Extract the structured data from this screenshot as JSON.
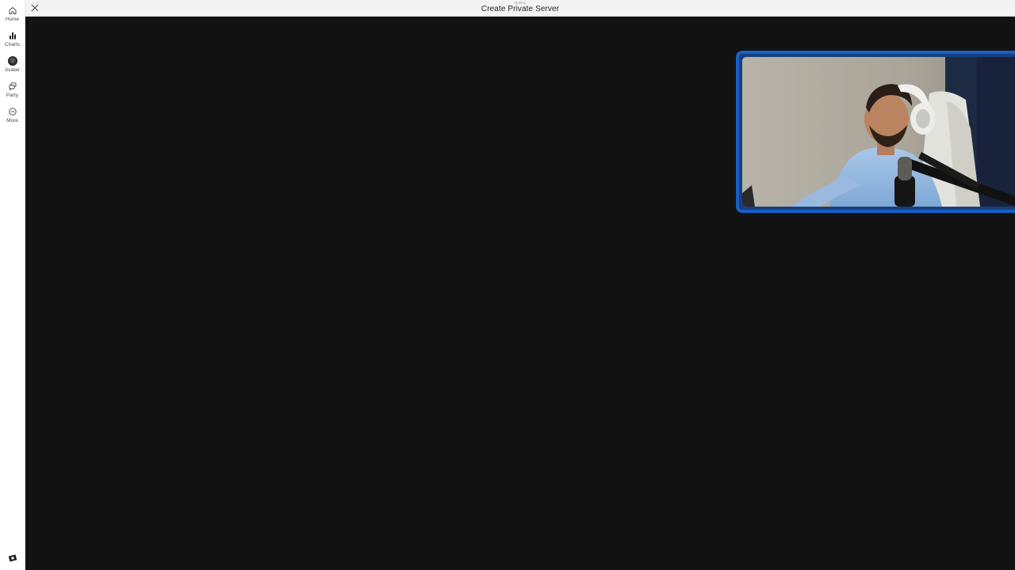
{
  "window": {
    "subtitle": "Roblox",
    "title": "Create Private Server"
  },
  "sidebar": {
    "items": [
      {
        "label": "Home",
        "icon": "home-icon"
      },
      {
        "label": "Charts",
        "icon": "chart-icon"
      },
      {
        "label": "Avatar",
        "icon": "avatar-icon"
      },
      {
        "label": "Party",
        "icon": "party-icon"
      },
      {
        "label": "More",
        "icon": "more-icon"
      }
    ],
    "bottom_icon": "roblox-logo-icon"
  },
  "webcam": {
    "description_icon": "webcam-overlay",
    "border_color": "#1a5fc4"
  },
  "colors": {
    "background": "#121212",
    "sidebar": "#ffffff",
    "topbar": "#f3f3f3",
    "accent": "#1a5fc4"
  }
}
